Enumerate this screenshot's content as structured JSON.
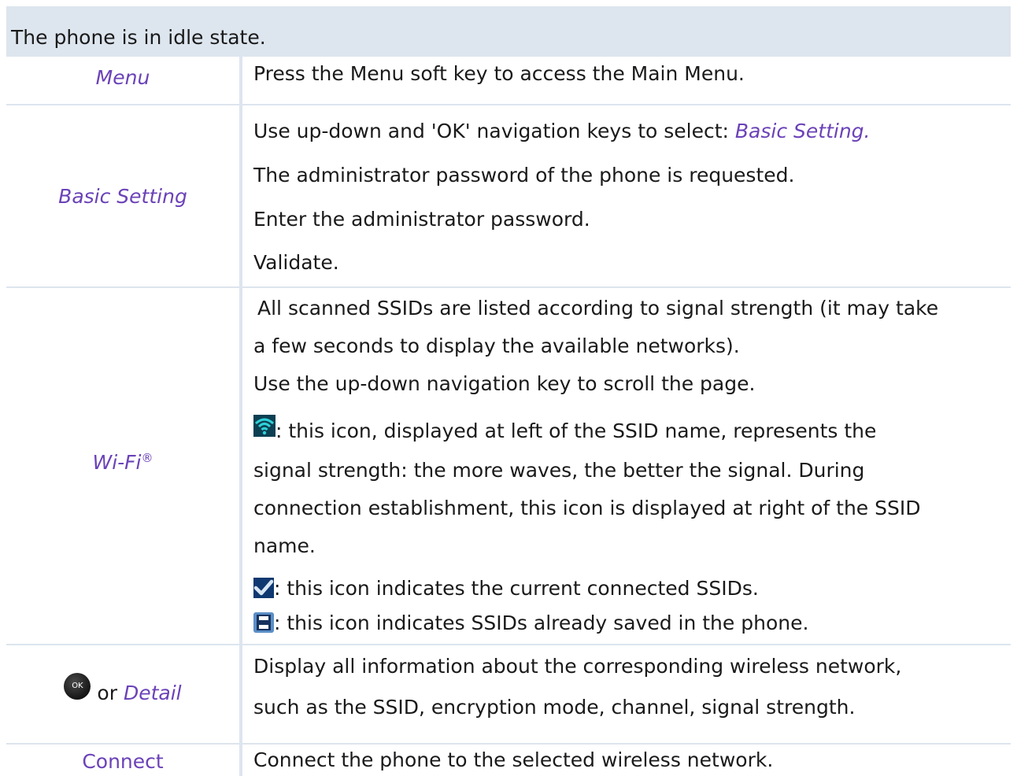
{
  "header": {
    "text": "The phone is in idle state."
  },
  "rows": {
    "menu": {
      "label": "Menu",
      "text": "Press the Menu soft key to access the Main Menu."
    },
    "basic": {
      "label": "Basic Setting",
      "line1_prefix": "Use up-down and 'OK' navigation keys to select:",
      "line1_emph": "Basic Setting.",
      "line2": "The administrator password of the phone is requested.",
      "line3": "Enter the administrator password.",
      "line4": "Validate."
    },
    "wifi": {
      "label": "Wi-Fi",
      "label_sup": "®",
      "line1": "All scanned SSIDs are listed according to signal strength (it may take",
      "line2": "a few seconds to display the available networks).",
      "line3": "Use the up-down navigation key to scroll the page.",
      "line4": ": this icon, displayed at left of the SSID name, represents the",
      "line5": "signal strength: the more waves, the better the signal. During",
      "line6": "connection establishment, this icon is displayed at right of the SSID",
      "line7": "name.",
      "line8": ": this icon indicates the current connected SSIDs.",
      "line9": ": this icon indicates SSIDs already saved in the phone."
    },
    "detail": {
      "ok_key": "OK",
      "or_text": "or",
      "label": "Detail",
      "line1": "Display all information about the corresponding wireless network,",
      "line2": "such as the SSID, encryption mode, channel, signal strength."
    },
    "connect": {
      "label": "Connect",
      "text": "Connect the phone to the selected wireless network."
    }
  },
  "icons": {
    "wifi": "wifi-signal-icon",
    "check": "checkmark-icon",
    "saved": "saved-icon",
    "ok": "ok-key-icon"
  },
  "colors": {
    "accent": "#6b42b8",
    "header_bg": "#dde5ee",
    "grid": "#dde5ee"
  }
}
